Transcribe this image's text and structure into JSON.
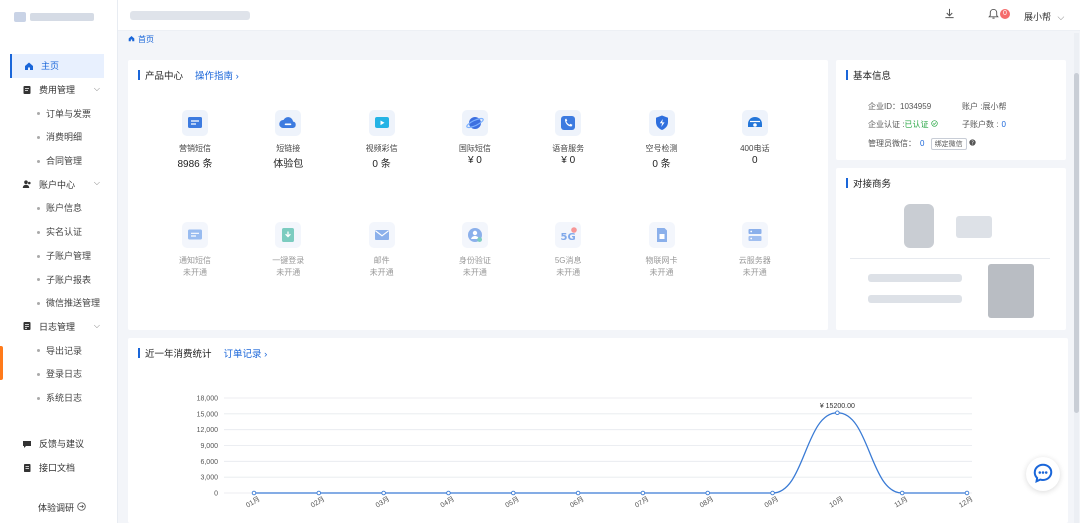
{
  "sidebar": {
    "items": [
      {
        "label": "主页",
        "icon": "home-icon",
        "active": true
      },
      {
        "label": "费用管理",
        "icon": "billing-icon",
        "group": true
      },
      {
        "label": "订单与发票",
        "sub": true
      },
      {
        "label": "消费明细",
        "sub": true
      },
      {
        "label": "合同管理",
        "sub": true
      },
      {
        "label": "账户中心",
        "icon": "user-group-icon",
        "group": true
      },
      {
        "label": "账户信息",
        "sub": true
      },
      {
        "label": "实名认证",
        "sub": true
      },
      {
        "label": "子账户管理",
        "sub": true
      },
      {
        "label": "子账户报表",
        "sub": true
      },
      {
        "label": "微信推送管理",
        "sub": true
      },
      {
        "label": "日志管理",
        "icon": "log-icon",
        "group": true
      },
      {
        "label": "导出记录",
        "sub": true
      },
      {
        "label": "登录日志",
        "sub": true
      },
      {
        "label": "系统日志",
        "sub": true
      }
    ],
    "bottom": [
      {
        "label": "反馈与建议",
        "icon": "feedback-icon"
      },
      {
        "label": "接口文档",
        "icon": "doc-icon"
      }
    ],
    "survey": "体验调研"
  },
  "topbar": {
    "badge": "0",
    "user": "展小帮"
  },
  "breadcrumb": "首页",
  "products": {
    "title": "产品中心",
    "guide": "操作指南",
    "items": [
      {
        "name": "营销短信",
        "value": "8986 条",
        "icon": "sms-icon"
      },
      {
        "name": "短链接",
        "value": "体验包",
        "icon": "link-cloud-icon"
      },
      {
        "name": "视频彩信",
        "value": "0 条",
        "icon": "video-icon"
      },
      {
        "name": "国际短信",
        "value": "¥ 0",
        "icon": "planet-icon"
      },
      {
        "name": "语音服务",
        "value": "¥ 0",
        "icon": "phone-icon"
      },
      {
        "name": "空号检测",
        "value": "0 条",
        "icon": "shield-check-icon"
      },
      {
        "name": "400电话",
        "value": "0",
        "icon": "telephone-icon"
      },
      {
        "name": "通知短信",
        "value": "未开通",
        "icon": "notice-icon",
        "off": true
      },
      {
        "name": "一键登录",
        "value": "未开通",
        "icon": "login-icon",
        "off": true
      },
      {
        "name": "邮件",
        "value": "未开通",
        "icon": "mail-icon",
        "off": true
      },
      {
        "name": "身份验证",
        "value": "未开通",
        "icon": "id-verify-icon",
        "off": true
      },
      {
        "name": "5G消息",
        "value": "未开通",
        "icon": "5g-icon",
        "off": true
      },
      {
        "name": "物联网卡",
        "value": "未开通",
        "icon": "sim-icon",
        "off": true
      },
      {
        "name": "云服务器",
        "value": "未开通",
        "icon": "server-icon",
        "off": true
      }
    ]
  },
  "basic": {
    "title": "基本信息",
    "company_id": "企业ID：1034959",
    "account": "账户 :展小帮",
    "cert_label": "企业认证 :",
    "cert_value": "已认证",
    "sub_label": "子账户数 :",
    "sub_value": "0",
    "admin_label": "管理员微信：",
    "admin_value": "0",
    "bind_btn": "绑定微信"
  },
  "partner": {
    "title": "对接商务"
  },
  "consumption": {
    "title": "近一年消费统计",
    "orders": "订单记录"
  },
  "colors": {
    "accent": "#1a66d9",
    "line": "#3a7bd5"
  },
  "chart_data": {
    "type": "line",
    "categories": [
      "01月",
      "02月",
      "03月",
      "04月",
      "05月",
      "06月",
      "07月",
      "08月",
      "09月",
      "10月",
      "11月",
      "12月"
    ],
    "series": [
      {
        "values": [
          0,
          0,
          0,
          0,
          0,
          0,
          0,
          0,
          0,
          15200,
          0,
          0
        ]
      }
    ],
    "yticks": [
      "0",
      "3,000",
      "6,000",
      "9,000",
      "12,000",
      "15,000",
      "18,000"
    ],
    "ylim": [
      0,
      18000
    ],
    "annotation": "¥ 15200.00",
    "grid": true,
    "smooth": true
  }
}
